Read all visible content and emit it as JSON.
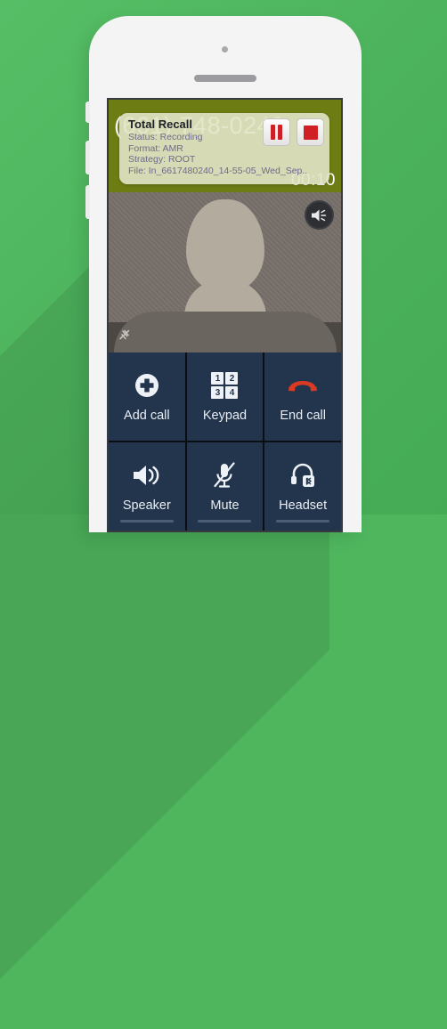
{
  "background": {
    "color": "#4fb65e"
  },
  "phone": {
    "device_color": "#f4f4f4",
    "camera_icon": "camera-dot",
    "earpiece_icon": "speaker-grille"
  },
  "call_screen": {
    "header_color": "#6d7d14",
    "caller_number": "(661) 748-0240",
    "call_timer": "00:10"
  },
  "recall_overlay": {
    "title": "Total Recall",
    "lines": [
      "Status: Recording",
      "Format: AMR",
      "Strategy: ROOT",
      "File: In_6617480240_14-55-05_Wed_Sep.."
    ],
    "pause_button": {
      "name": "pause-recording",
      "icon": "pause-icon",
      "color": "#cc2027"
    },
    "stop_button": {
      "name": "stop-recording",
      "icon": "stop-icon",
      "color": "#d02026"
    }
  },
  "avatar": {
    "icon": "contact-silhouette",
    "speaker_toggle_icon": "speaker-icon",
    "mute_indicator_icon": "mic-muted-icon"
  },
  "call_controls": {
    "accent_color": "#22354d",
    "end_call_color": "#d83a22",
    "buttons": [
      {
        "label": "Add call",
        "icon": "add-call-icon"
      },
      {
        "label": "Keypad",
        "icon": "keypad-icon",
        "keys": [
          "1",
          "2",
          "3",
          "4"
        ]
      },
      {
        "label": "End call",
        "icon": "end-call-icon"
      },
      {
        "label": "Speaker",
        "icon": "speaker-icon"
      },
      {
        "label": "Mute",
        "icon": "mic-muted-icon"
      },
      {
        "label": "Headset",
        "icon": "bluetooth-headset-icon"
      }
    ]
  }
}
